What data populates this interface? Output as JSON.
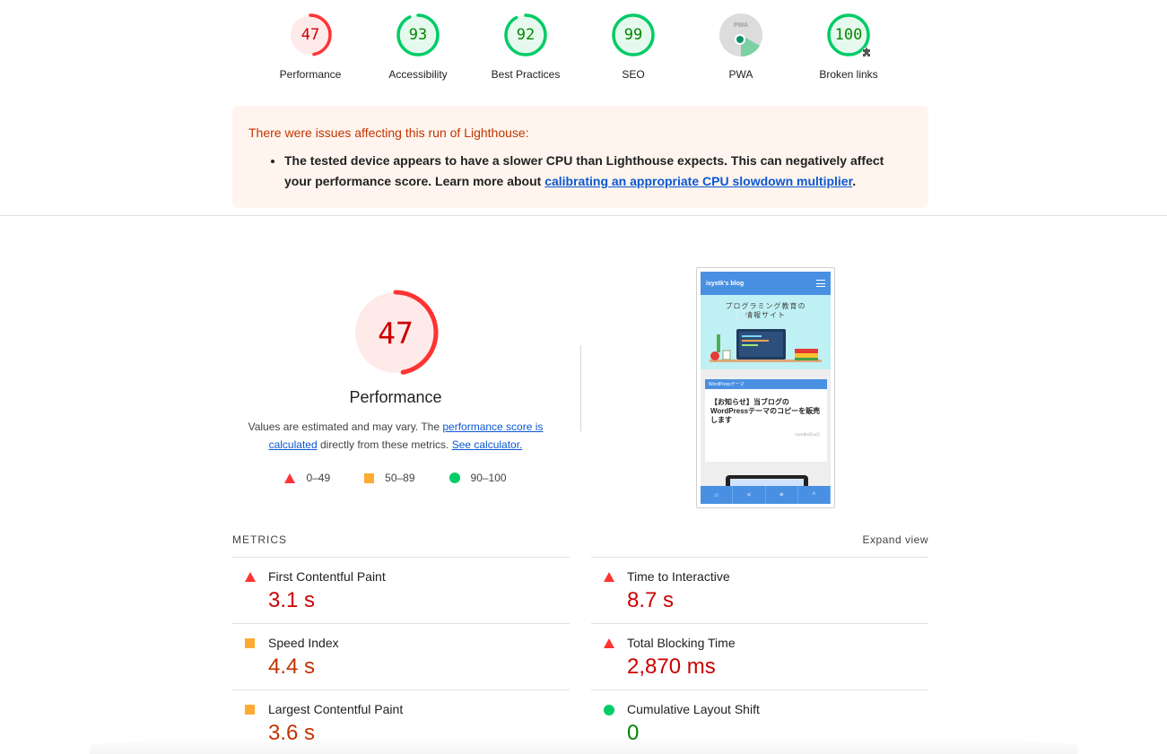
{
  "gauges": [
    {
      "score": "47",
      "label": "Performance",
      "status": "fail",
      "fraction": 0.47,
      "color": "#ff3333"
    },
    {
      "score": "93",
      "label": "Accessibility",
      "status": "pass",
      "fraction": 0.93,
      "color": "#00cc66"
    },
    {
      "score": "92",
      "label": "Best Practices",
      "status": "pass",
      "fraction": 0.92,
      "color": "#00cc66"
    },
    {
      "score": "99",
      "label": "SEO",
      "status": "pass",
      "fraction": 0.99,
      "color": "#00cc66"
    },
    {
      "score": "",
      "label": "PWA",
      "status": "pwa",
      "badge": "PWA"
    },
    {
      "score": "100",
      "label": "Broken links",
      "status": "pass",
      "fraction": 1.0,
      "color": "#00cc66",
      "icon": "puzzle-icon"
    }
  ],
  "warning": {
    "title": "There were issues affecting this run of Lighthouse:",
    "item_text": "The tested device appears to have a slower CPU than Lighthouse expects. This can negatively affect your performance score. Learn more about ",
    "item_link": "calibrating an appropriate CPU slowdown multiplier",
    "item_end": "."
  },
  "performance": {
    "score": "47",
    "fraction": 0.47,
    "title": "Performance",
    "desc_1": "Values are estimated and may vary. The ",
    "desc_link_1": "performance score is calculated",
    "desc_2": " directly from these metrics. ",
    "desc_link_2": "See calculator.",
    "legend": [
      {
        "shape": "triangle",
        "range": "0–49"
      },
      {
        "shape": "square",
        "range": "50–89"
      },
      {
        "shape": "circle",
        "range": "90–100"
      }
    ]
  },
  "screenshot": {
    "site_title": "isystk's blog",
    "hero_text_1": "プログラミング教育の",
    "hero_text_2": "情報サイト",
    "card_tag": "WordPressテーマ",
    "card_title": "【お知らせ】当ブログのWordPressテーマのコピーを販売します",
    "card_date": "2020年5月16日",
    "footer_icons": [
      "⌂",
      "<",
      "≡",
      "^"
    ]
  },
  "metrics": {
    "title": "METRICS",
    "expand": "Expand view",
    "items": [
      {
        "name": "First Contentful Paint",
        "value": "3.1 s",
        "status": "fail"
      },
      {
        "name": "Time to Interactive",
        "value": "8.7 s",
        "status": "fail"
      },
      {
        "name": "Speed Index",
        "value": "4.4 s",
        "status": "average"
      },
      {
        "name": "Total Blocking Time",
        "value": "2,870 ms",
        "status": "fail"
      },
      {
        "name": "Largest Contentful Paint",
        "value": "3.6 s",
        "status": "average"
      },
      {
        "name": "Cumulative Layout Shift",
        "value": "0",
        "status": "pass"
      }
    ]
  }
}
